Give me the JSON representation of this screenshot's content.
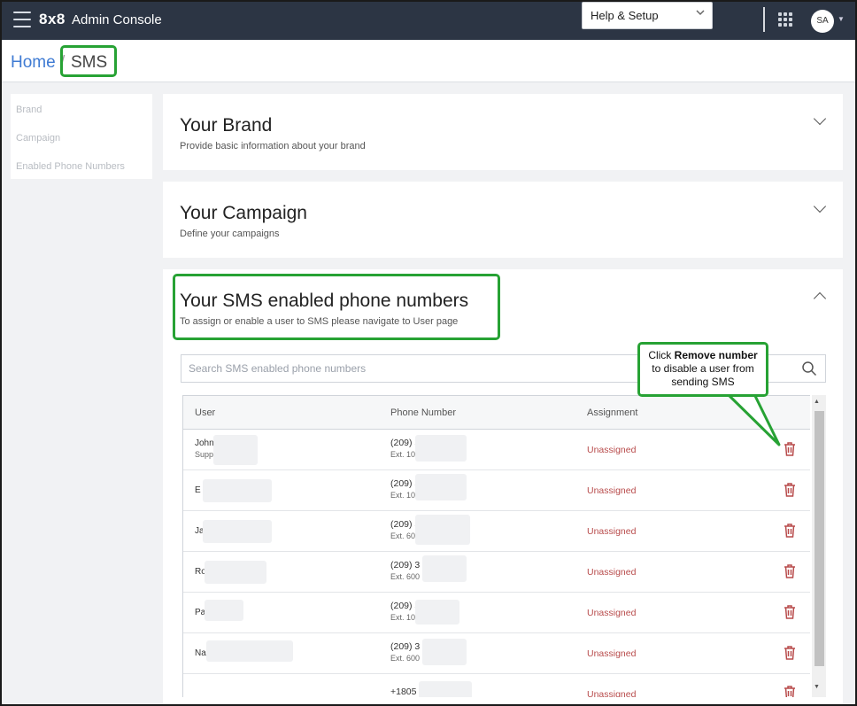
{
  "header": {
    "logo": "8x8",
    "app_title": "Admin Console",
    "help_label": "Help & Setup",
    "avatar_initials": "SA"
  },
  "breadcrumb": {
    "home": "Home",
    "separator": "/",
    "current": "SMS"
  },
  "sidebar": {
    "items": [
      {
        "label": "Brand"
      },
      {
        "label": "Campaign"
      },
      {
        "label": "Enabled Phone Numbers"
      }
    ]
  },
  "cards": {
    "brand": {
      "title": "Your Brand",
      "subtitle": "Provide basic information about your brand"
    },
    "campaign": {
      "title": "Your Campaign",
      "subtitle": "Define your campaigns"
    },
    "numbers": {
      "title": "Your SMS enabled phone numbers",
      "subtitle": "To assign or enable a user to SMS please navigate to User page"
    }
  },
  "search": {
    "placeholder": "Search SMS enabled phone numbers"
  },
  "table": {
    "columns": [
      "User",
      "Phone Number",
      "Assignment"
    ],
    "rows": [
      {
        "user": "John",
        "user_sub": "Supp",
        "phone": "(209) 3",
        "ext": "Ext. 100",
        "assignment": "Unassigned"
      },
      {
        "user": "E",
        "user_sub": "",
        "phone": "(209) 3",
        "ext": "Ext. 100",
        "assignment": "Unassigned"
      },
      {
        "user": "Ja",
        "user_sub": "",
        "phone": "(209) 3",
        "ext": "Ext. 600",
        "assignment": "Unassigned"
      },
      {
        "user": "Ro",
        "user_sub": "",
        "phone": "(209) 3",
        "ext": "Ext. 600",
        "assignment": "Unassigned"
      },
      {
        "user": "Pa",
        "user_sub": "",
        "phone": "(209) 3",
        "ext": "Ext. 100",
        "assignment": "Unassigned"
      },
      {
        "user": "Na",
        "user_sub": "",
        "phone": "(209) 3",
        "ext": "Ext. 600",
        "assignment": "Unassigned"
      },
      {
        "user": "",
        "user_sub": "",
        "phone": "+1805",
        "ext": "",
        "assignment": "Unassigned"
      }
    ]
  },
  "callout": {
    "line1_prefix": "Click ",
    "line1_bold": "Remove number",
    "line2": "to disable a user from",
    "line3": "sending SMS"
  },
  "colors": {
    "topbar": "#2c3544",
    "link": "#3f7bd3",
    "highlight": "#27a234",
    "danger": "#b84b4b"
  }
}
